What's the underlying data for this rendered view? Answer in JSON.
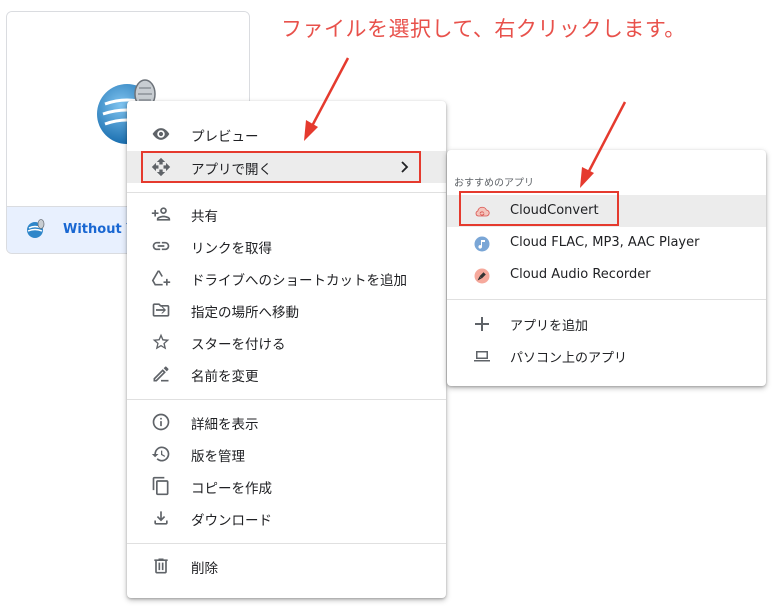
{
  "annotation": {
    "text": "ファイルを選択して、右クリックします。",
    "color": "#e8514b"
  },
  "file_card": {
    "name": "Without Yo",
    "thumbnail_icon": "microphone-globe-icon",
    "footer_icon": "audio-file-icon"
  },
  "context_menu": {
    "items": [
      {
        "label": "プレビュー",
        "icon": "eye-icon"
      },
      {
        "label": "アプリで開く",
        "icon": "move-arrows-icon",
        "has_submenu": true,
        "highlighted": true
      },
      {
        "label": "共有",
        "icon": "person-add-icon"
      },
      {
        "label": "リンクを取得",
        "icon": "link-icon"
      },
      {
        "label": "ドライブへのショートカットを追加",
        "icon": "drive-add-icon"
      },
      {
        "label": "指定の場所へ移動",
        "icon": "folder-move-icon"
      },
      {
        "label": "スターを付ける",
        "icon": "star-icon"
      },
      {
        "label": "名前を変更",
        "icon": "pencil-icon"
      },
      {
        "label": "詳細を表示",
        "icon": "info-icon"
      },
      {
        "label": "版を管理",
        "icon": "history-icon"
      },
      {
        "label": "コピーを作成",
        "icon": "copy-icon"
      },
      {
        "label": "ダウンロード",
        "icon": "download-icon"
      },
      {
        "label": "削除",
        "icon": "trash-icon"
      }
    ]
  },
  "submenu": {
    "header": "おすすめのアプリ",
    "suggested": [
      {
        "label": "CloudConvert",
        "icon": "cloudconvert-icon",
        "highlighted": true
      },
      {
        "label": "Cloud FLAC, MP3, AAC Player",
        "icon": "music-note-icon"
      },
      {
        "label": "Cloud Audio Recorder",
        "icon": "microphone-icon"
      }
    ],
    "actions": [
      {
        "label": "アプリを追加",
        "icon": "plus-icon"
      },
      {
        "label": "パソコン上のアプリ",
        "icon": "laptop-icon"
      }
    ]
  },
  "colors": {
    "highlight_border": "#e53a2e",
    "selected_bg": "#e8f0fe",
    "file_name": "#1967d2"
  }
}
